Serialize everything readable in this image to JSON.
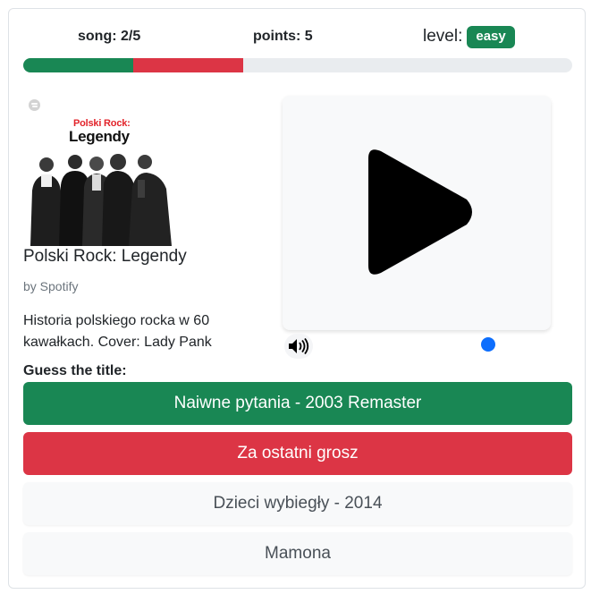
{
  "header": {
    "song_label": "song: 2/5",
    "points_label": "points: 5",
    "level_label": "level:",
    "level_value": "easy"
  },
  "progress": {
    "segments": [
      {
        "status": "correct",
        "fraction": 0.2,
        "color": "#198754"
      },
      {
        "status": "wrong",
        "fraction": 0.2,
        "color": "#dc3545"
      }
    ],
    "track_color": "#e9ecef"
  },
  "playlist": {
    "cover_brand": "Polski Rock:",
    "cover_title": "Legendy",
    "title": "Polski Rock: Legendy",
    "owner": "by Spotify",
    "description": "Historia polskiego rocka w 60 kawałkach. Cover: Lady Pank",
    "source_icon": "spotify-icon"
  },
  "player": {
    "play_icon": "play-icon",
    "volume_icon": "volume-icon",
    "volume_fraction": 0.95,
    "accent_color": "#0d6efd"
  },
  "guess": {
    "label": "Guess the title:",
    "answers": [
      {
        "label": "Naiwne pytania - 2003 Remaster",
        "state": "correct"
      },
      {
        "label": "Za ostatni grosz",
        "state": "wrong"
      },
      {
        "label": "Dzieci wybiegły - 2014",
        "state": "neutral"
      },
      {
        "label": "Mamona",
        "state": "neutral"
      }
    ]
  },
  "colors": {
    "success": "#198754",
    "danger": "#dc3545",
    "neutral": "#f8f9fa"
  }
}
